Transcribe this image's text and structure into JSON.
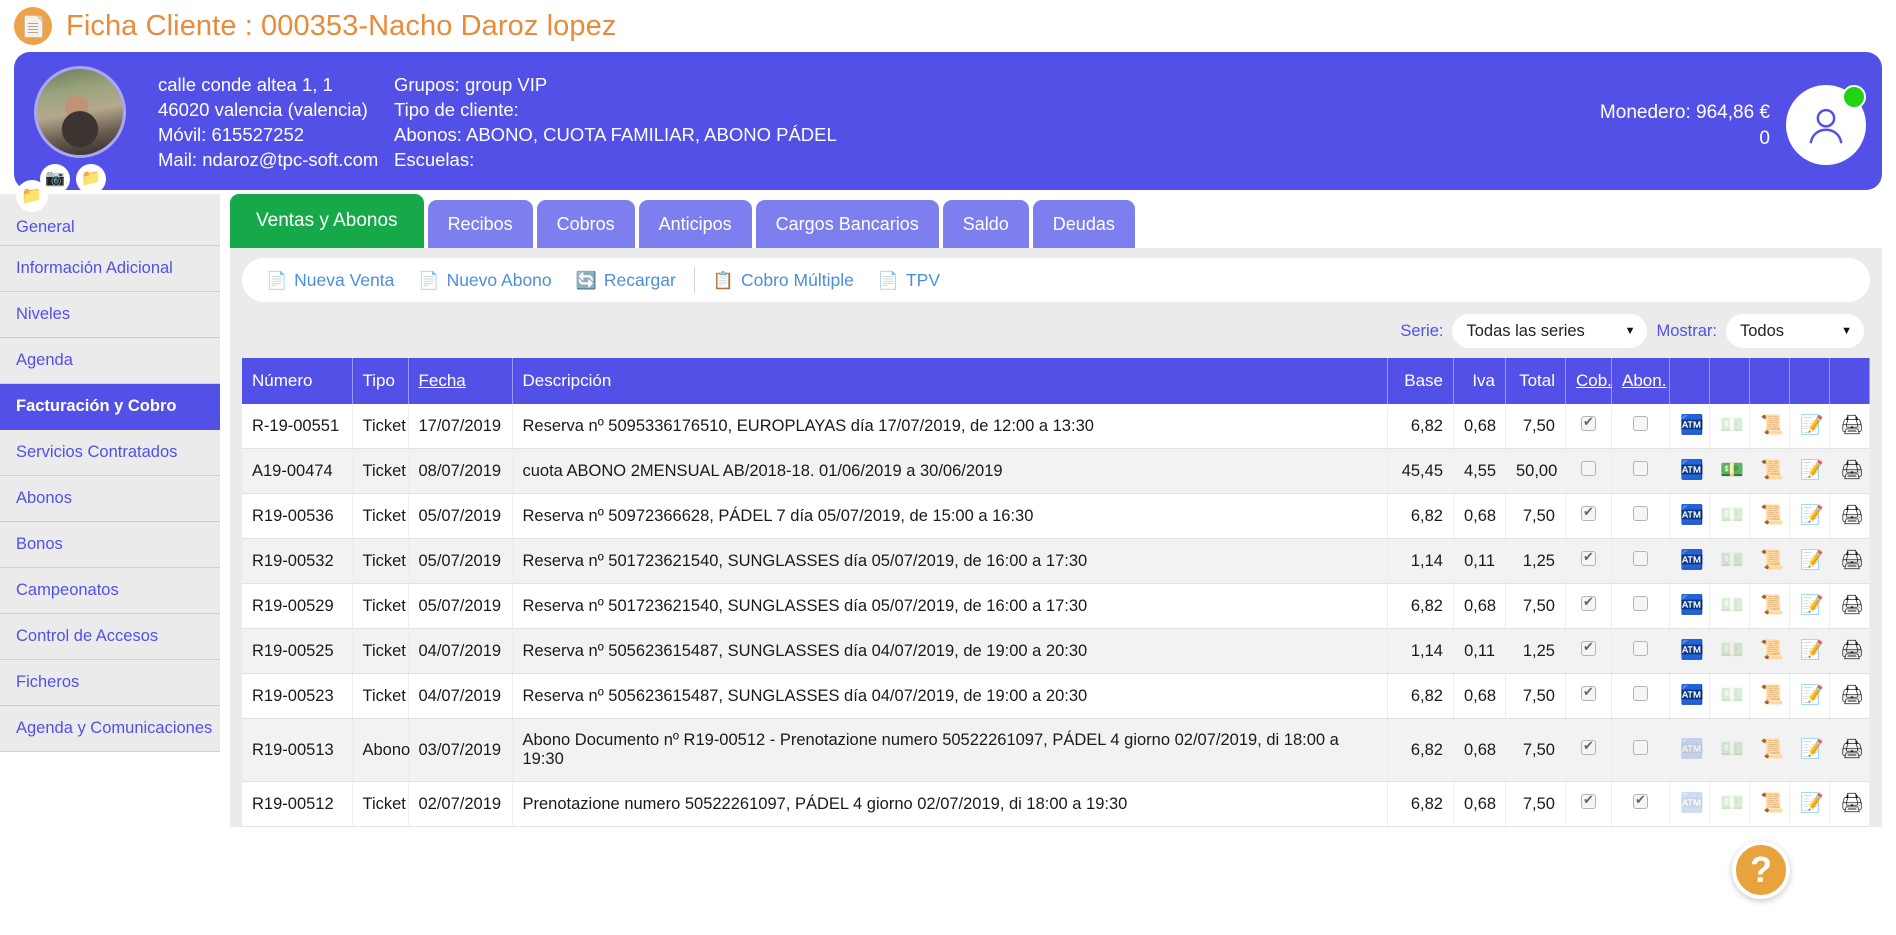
{
  "page": {
    "title": "Ficha Cliente : 000353-Nacho Daroz lopez",
    "title_icon": "document-icon"
  },
  "client": {
    "avatar_icons": [
      {
        "name": "camera-icon",
        "glyph": "📷"
      },
      {
        "name": "folder-icon",
        "glyph": "📁"
      }
    ],
    "address_line1": "calle conde altea 1, 1",
    "address_line2": "46020 valencia (valencia)",
    "mobile": "Móvil: 615527252",
    "mail": "Mail: ndaroz@tpc-soft.com",
    "grupos": "Grupos: group VIP",
    "tipo_cliente": "Tipo de cliente:",
    "abonos": "Abonos: ABONO, CUOTA FAMILIAR, ABONO PÁDEL",
    "escuelas": "Escuelas:",
    "wallet_label": "Monedero: 964,86 €",
    "wallet_secondary": "0",
    "status_color": "#22d214"
  },
  "sidebar": {
    "folder_icon": "folder-icon",
    "items": [
      {
        "label": "General",
        "active": false
      },
      {
        "label": "Información Adicional",
        "active": false
      },
      {
        "label": "Niveles",
        "active": false
      },
      {
        "label": "Agenda",
        "active": false
      },
      {
        "label": "Facturación y Cobro",
        "active": true
      },
      {
        "label": "Servicios Contratados",
        "active": false
      },
      {
        "label": "Abonos",
        "active": false
      },
      {
        "label": "Bonos",
        "active": false
      },
      {
        "label": "Campeonatos",
        "active": false
      },
      {
        "label": "Control de Accesos",
        "active": false
      },
      {
        "label": "Ficheros",
        "active": false
      },
      {
        "label": "Agenda y Comunicaciones",
        "active": false
      }
    ]
  },
  "tabs": [
    {
      "label": "Ventas y Abonos",
      "active": true
    },
    {
      "label": "Recibos",
      "active": false
    },
    {
      "label": "Cobros",
      "active": false
    },
    {
      "label": "Anticipos",
      "active": false
    },
    {
      "label": "Cargos Bancarios",
      "active": false
    },
    {
      "label": "Saldo",
      "active": false
    },
    {
      "label": "Deudas",
      "active": false
    }
  ],
  "toolbar": {
    "actions": [
      {
        "label": "Nueva Venta",
        "icon": "new-document-icon",
        "glyph": "📄",
        "sep_after": false
      },
      {
        "label": "Nuevo Abono",
        "icon": "new-document-icon",
        "glyph": "📄",
        "sep_after": false
      },
      {
        "label": "Recargar",
        "icon": "refresh-icon",
        "glyph": "🔄",
        "sep_after": true
      },
      {
        "label": "Cobro Múltiple",
        "icon": "list-document-icon",
        "glyph": "📋",
        "sep_after": false
      },
      {
        "label": "TPV",
        "icon": "document-icon",
        "glyph": "📄",
        "sep_after": false
      }
    ]
  },
  "filters": {
    "serie_label": "Serie:",
    "serie_value": "Todas las series",
    "mostrar_label": "Mostrar:",
    "mostrar_value": "Todos",
    "caret": "▼"
  },
  "table": {
    "columns": [
      {
        "key": "numero",
        "label": "Número",
        "sorted": false
      },
      {
        "key": "tipo",
        "label": "Tipo",
        "sorted": false
      },
      {
        "key": "fecha",
        "label": "Fecha",
        "sorted": true
      },
      {
        "key": "descripcion",
        "label": "Descripción",
        "sorted": false
      },
      {
        "key": "base",
        "label": "Base",
        "sorted": false
      },
      {
        "key": "iva",
        "label": "Iva",
        "sorted": false
      },
      {
        "key": "total",
        "label": "Total",
        "sorted": false
      },
      {
        "key": "cob",
        "label": "Cob.",
        "sorted": true
      },
      {
        "key": "abon",
        "label": "Abon.",
        "sorted": true
      },
      {
        "key": "a1",
        "label": "",
        "sorted": false
      },
      {
        "key": "a2",
        "label": "",
        "sorted": false
      },
      {
        "key": "a3",
        "label": "",
        "sorted": false
      },
      {
        "key": "a4",
        "label": "",
        "sorted": false
      },
      {
        "key": "a5",
        "label": "",
        "sorted": false
      }
    ],
    "row_icons": [
      {
        "name": "cobrar-icon",
        "glyph": "🏧"
      },
      {
        "name": "abonar-icon",
        "glyph": "💵"
      },
      {
        "name": "cobro-documento-icon",
        "glyph": "📜"
      },
      {
        "name": "editar-icon",
        "glyph": "📝"
      },
      {
        "name": "imprimir-icon",
        "glyph": "🖨"
      }
    ],
    "rows": [
      {
        "numero": "R-19-00551",
        "tipo": "Ticket",
        "fecha": "17/07/2019",
        "descripcion": "Reserva nº 5095336176510, EUROPLAYAS día 17/07/2019, de 12:00 a 13:30",
        "base": "6,82",
        "iva": "0,68",
        "total": "7,50",
        "cob": true,
        "abon": false,
        "icon_states": [
          true,
          false,
          true,
          true,
          true
        ]
      },
      {
        "numero": "A19-00474",
        "tipo": "Ticket",
        "fecha": "08/07/2019",
        "descripcion": "cuota ABONO 2MENSUAL AB/2018-18. 01/06/2019 a 30/06/2019",
        "base": "45,45",
        "iva": "4,55",
        "total": "50,00",
        "cob": false,
        "abon": false,
        "icon_states": [
          true,
          true,
          true,
          true,
          true
        ]
      },
      {
        "numero": "R19-00536",
        "tipo": "Ticket",
        "fecha": "05/07/2019",
        "descripcion": "Reserva nº 50972366628, PÁDEL 7 día 05/07/2019, de 15:00 a 16:30",
        "base": "6,82",
        "iva": "0,68",
        "total": "7,50",
        "cob": true,
        "abon": false,
        "icon_states": [
          true,
          false,
          true,
          true,
          true
        ]
      },
      {
        "numero": "R19-00532",
        "tipo": "Ticket",
        "fecha": "05/07/2019",
        "descripcion": "Reserva nº 501723621540, SUNGLASSES día 05/07/2019, de 16:00 a 17:30",
        "base": "1,14",
        "iva": "0,11",
        "total": "1,25",
        "cob": true,
        "abon": false,
        "icon_states": [
          true,
          false,
          true,
          true,
          true
        ]
      },
      {
        "numero": "R19-00529",
        "tipo": "Ticket",
        "fecha": "05/07/2019",
        "descripcion": "Reserva nº 501723621540, SUNGLASSES día 05/07/2019, de 16:00 a 17:30",
        "base": "6,82",
        "iva": "0,68",
        "total": "7,50",
        "cob": true,
        "abon": false,
        "icon_states": [
          true,
          false,
          true,
          true,
          true
        ]
      },
      {
        "numero": "R19-00525",
        "tipo": "Ticket",
        "fecha": "04/07/2019",
        "descripcion": "Reserva nº 505623615487, SUNGLASSES día 04/07/2019, de 19:00 a 20:30",
        "base": "1,14",
        "iva": "0,11",
        "total": "1,25",
        "cob": true,
        "abon": false,
        "icon_states": [
          true,
          false,
          true,
          true,
          true
        ]
      },
      {
        "numero": "R19-00523",
        "tipo": "Ticket",
        "fecha": "04/07/2019",
        "descripcion": "Reserva nº 505623615487, SUNGLASSES día 04/07/2019, de 19:00 a 20:30",
        "base": "6,82",
        "iva": "0,68",
        "total": "7,50",
        "cob": true,
        "abon": false,
        "icon_states": [
          true,
          false,
          true,
          true,
          true
        ]
      },
      {
        "numero": "R19-00513",
        "tipo": "Abono",
        "fecha": "03/07/2019",
        "descripcion": "Abono Documento nº R19-00512 - Prenotazione numero 50522261097, PÁDEL 4 giorno 02/07/2019, di 18:00 a 19:30",
        "base": "6,82",
        "iva": "0,68",
        "total": "7,50",
        "cob": true,
        "abon": false,
        "icon_states": [
          false,
          false,
          true,
          true,
          true
        ]
      },
      {
        "numero": "R19-00512",
        "tipo": "Ticket",
        "fecha": "02/07/2019",
        "descripcion": "Prenotazione numero 50522261097, PÁDEL 4 giorno 02/07/2019, di 18:00 a 19:30",
        "base": "6,82",
        "iva": "0,68",
        "total": "7,50",
        "cob": true,
        "abon": true,
        "icon_states": [
          false,
          false,
          true,
          true,
          true
        ]
      }
    ]
  },
  "help": {
    "label": "?"
  }
}
